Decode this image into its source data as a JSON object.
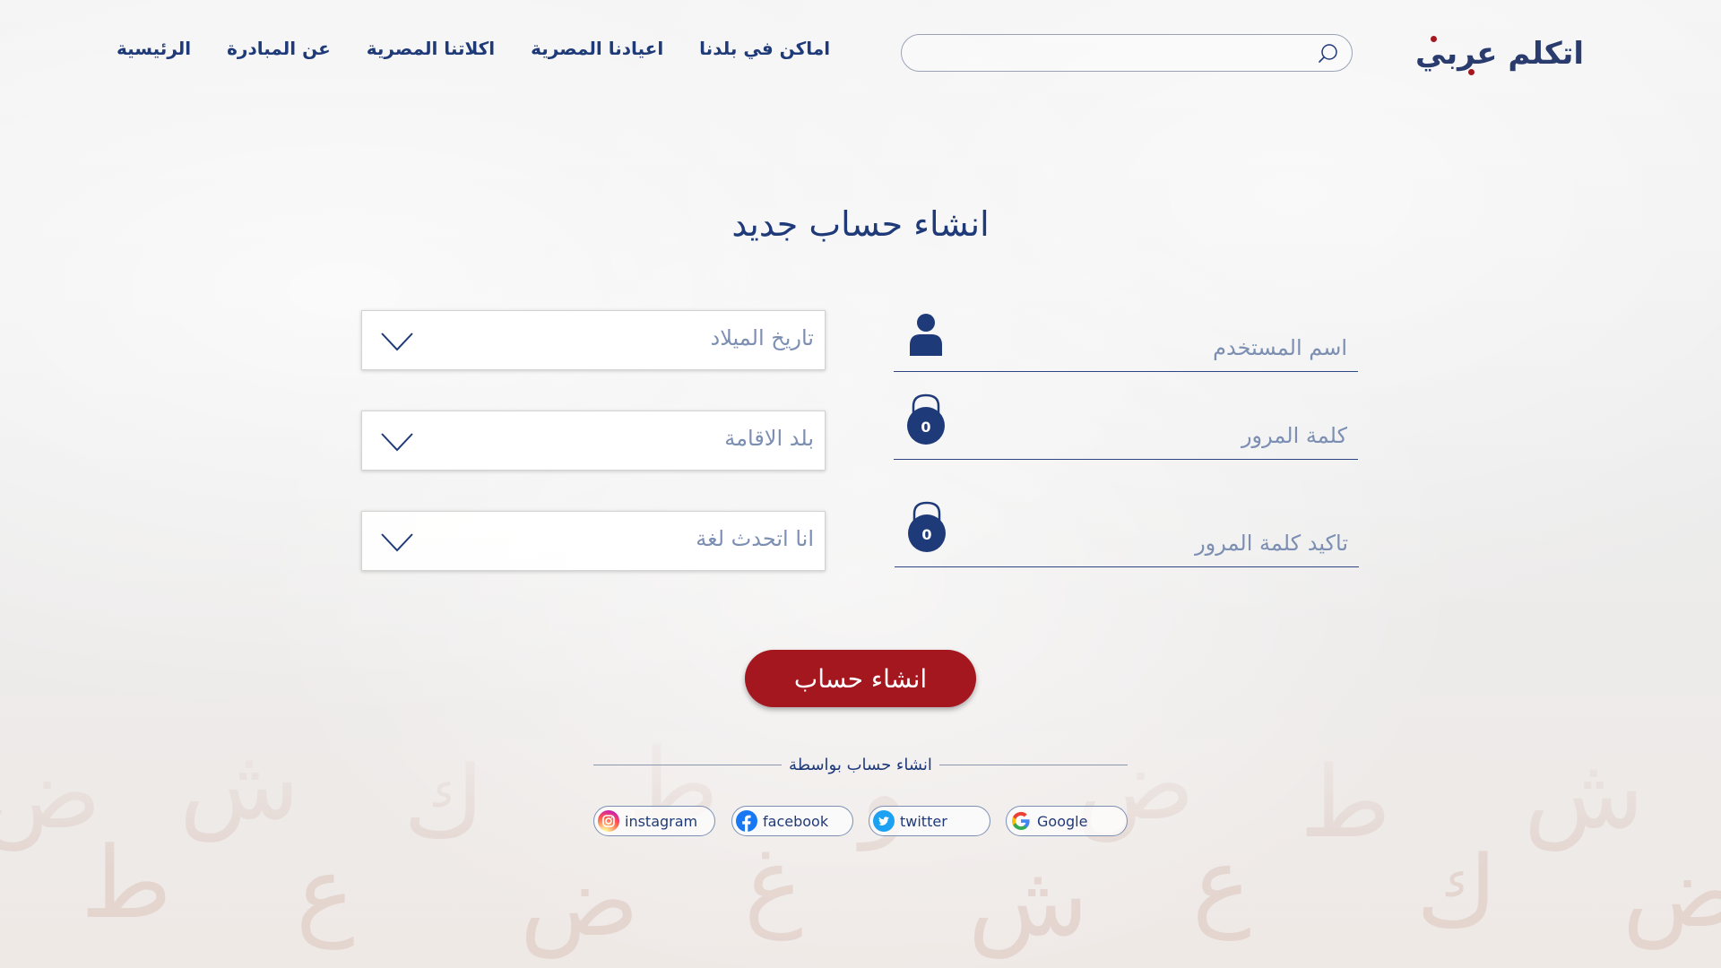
{
  "header": {
    "logo_text": "اتكلم عربي",
    "search": {
      "value": "",
      "placeholder": ""
    },
    "nav": [
      {
        "label": "الرئيسية"
      },
      {
        "label": "عن المبادرة"
      },
      {
        "label": "اكلاتنا المصرية"
      },
      {
        "label": "اعيادنا المصرية"
      },
      {
        "label": "اماكن في بلدنا"
      }
    ]
  },
  "main": {
    "title": "انشاء حساب جديد",
    "fields": {
      "username_placeholder": "اسم المستخدم",
      "password_placeholder": "كلمة المرور",
      "password_confirm_placeholder": "تاكيد كلمة المرور"
    },
    "selects": {
      "birthdate": "تاريخ الميلاد",
      "country": "بلد الاقامة",
      "language": "انا اتحدث لغة"
    },
    "submit_label": "انشاء حساب",
    "divider_label": "انشاء حساب بواسطة",
    "social": [
      {
        "label": "Google",
        "icon": "google-icon"
      },
      {
        "label": "twitter",
        "icon": "twitter-icon"
      },
      {
        "label": "facebook",
        "icon": "facebook-icon"
      },
      {
        "label": "instagram",
        "icon": "instagram-icon"
      }
    ],
    "lock_digit": "0"
  },
  "colors": {
    "primary": "#1f3a78",
    "accent": "#a5171f",
    "placeholder": "#7c8fb3"
  }
}
